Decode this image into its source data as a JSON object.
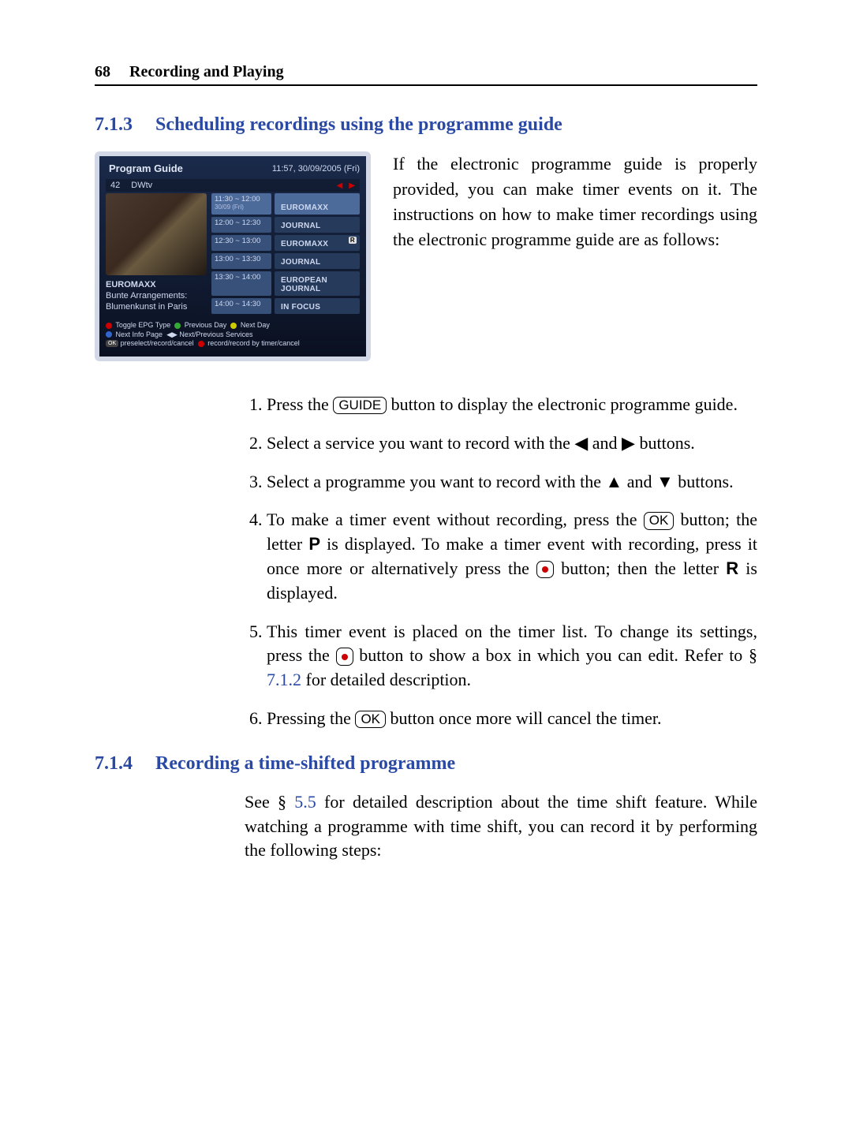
{
  "page_number": "68",
  "header_title": "Recording and Playing",
  "section713": {
    "num": "7.1.3",
    "title": "Scheduling recordings using the programme guide",
    "intro": "If the electronic programme guide is properly provided, you can make timer events on it. The instructions on how to make timer recordings using the electronic programme guide are as follows:"
  },
  "epg": {
    "title": "Program Guide",
    "clock": "11:57, 30/09/2005 (Fri)",
    "channel_no": "42",
    "channel_name": "DWtv",
    "left_title": "EUROMAXX",
    "left_sub1": "Bunte Arrangements:",
    "left_sub2": "Blumenkunst in Paris",
    "rows": [
      {
        "time": "11:30 ~ 12:00",
        "date": "30/09 (Fri)",
        "name": "EUROMAXX",
        "sel": true
      },
      {
        "time": "12:00 ~ 12:30",
        "date": "",
        "name": "JOURNAL"
      },
      {
        "time": "12:30 ~ 13:00",
        "date": "",
        "name": "EUROMAXX",
        "badge": "R"
      },
      {
        "time": "13:00 ~ 13:30",
        "date": "",
        "name": "JOURNAL"
      },
      {
        "time": "13:30 ~ 14:00",
        "date": "",
        "name": "EUROPEAN JOURNAL"
      },
      {
        "time": "14:00 ~ 14:30",
        "date": "",
        "name": "IN FOCUS"
      }
    ],
    "foot1a": "Toggle EPG Type",
    "foot1b": "Previous Day",
    "foot1c": "Next Day",
    "foot2a": "Next Info Page",
    "foot2b": "Next/Previous Services",
    "foot3a": "preselect/record/cancel",
    "foot3b": "record/record by timer/cancel"
  },
  "steps": {
    "s1a": "Press the ",
    "s1_key": "GUIDE",
    "s1b": " button to display the electronic programme guide.",
    "s2a": "Select a service you want to record with the ◀ and ▶ buttons.",
    "s3a": "Select a programme you want to record with the ▲ and ▼ buttons.",
    "s4a": "To make a timer event without recording, press the ",
    "s4_ok": "OK",
    "s4b": " button; the letter ",
    "s4_p": "P",
    "s4c": " is displayed. To make a timer event with recording, press it once more or alternatively press the ",
    "s4d": " button; then the letter ",
    "s4_r": "R",
    "s4e": " is displayed.",
    "s5a": "This timer event is placed on the timer list. To change its settings, press the ",
    "s5b": " button to show a box in which you can edit. Refer to § ",
    "s5_link": "7.1.2",
    "s5c": " for detailed description.",
    "s6a": "Pressing the ",
    "s6_ok": "OK",
    "s6b": " button once more will cancel the timer."
  },
  "section714": {
    "num": "7.1.4",
    "title": "Recording a time-shifted programme",
    "para_a": "See § ",
    "para_link": "5.5",
    "para_b": " for detailed description about the time shift feature. While watching a programme with time shift, you can record it by performing the following steps:"
  }
}
